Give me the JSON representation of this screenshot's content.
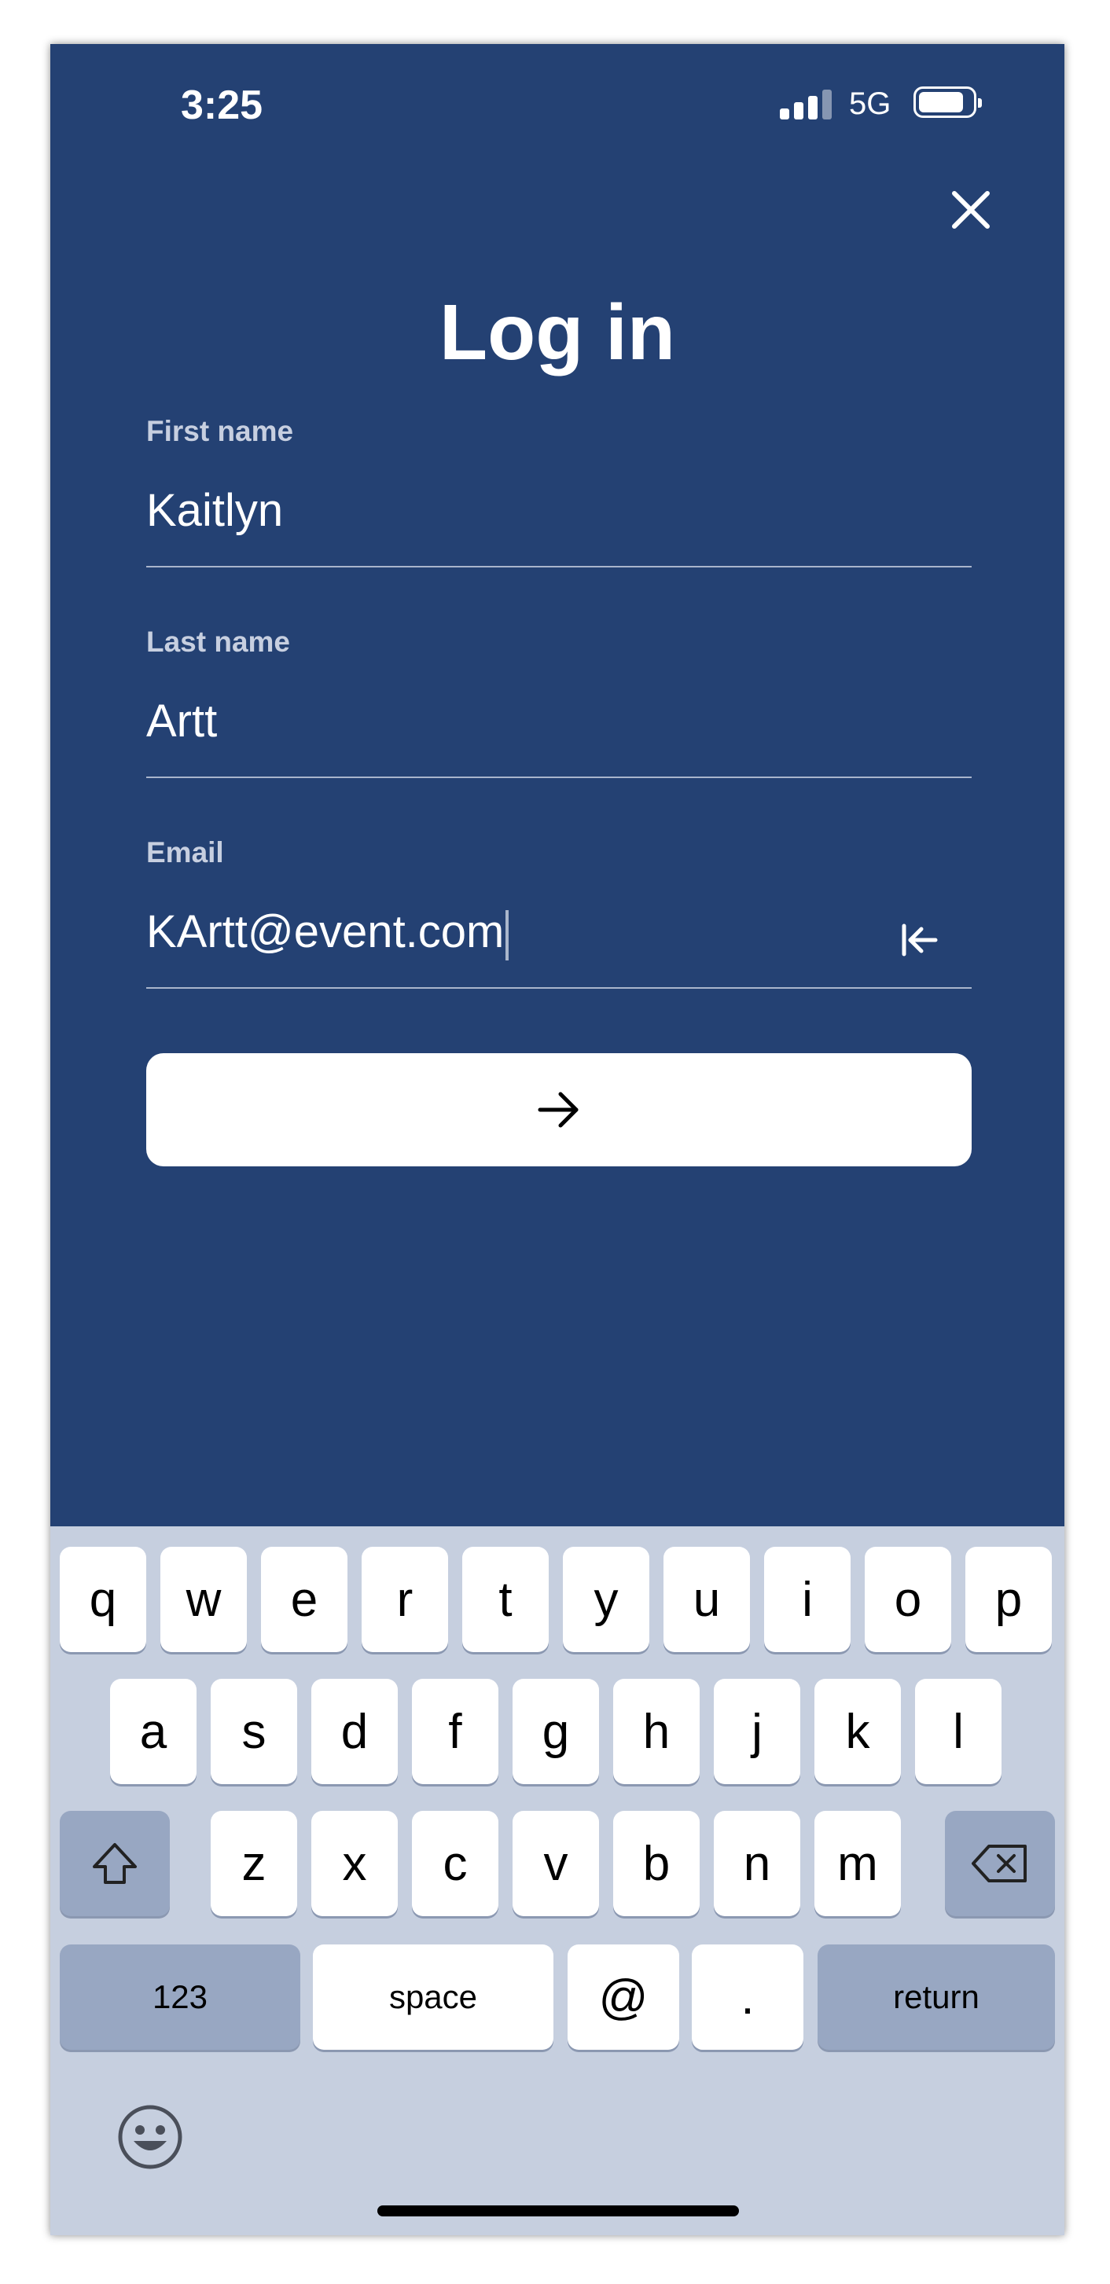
{
  "status_bar": {
    "time": "3:25",
    "network": "5G"
  },
  "page": {
    "title": "Log in"
  },
  "form": {
    "first_name": {
      "label": "First name",
      "value": "Kaitlyn"
    },
    "last_name": {
      "label": "Last name",
      "value": "Artt"
    },
    "email": {
      "label": "Email",
      "value": "KArtt@event.com"
    }
  },
  "keyboard": {
    "row1": [
      "q",
      "w",
      "e",
      "r",
      "t",
      "y",
      "u",
      "i",
      "o",
      "p"
    ],
    "row2": [
      "a",
      "s",
      "d",
      "f",
      "g",
      "h",
      "j",
      "k",
      "l"
    ],
    "row3": [
      "z",
      "x",
      "c",
      "v",
      "b",
      "n",
      "m"
    ],
    "numbers_label": "123",
    "space_label": "space",
    "at_label": "@",
    "dot_label": ".",
    "return_label": "return"
  },
  "icons": {
    "close": "close-icon",
    "clear": "clear-text-icon",
    "submit": "arrow-right-icon",
    "shift": "shift-icon",
    "backspace": "backspace-icon",
    "emoji": "emoji-icon"
  },
  "colors": {
    "background": "#244173",
    "keyboard": "#c6cfdf",
    "button": "#ffffff"
  }
}
